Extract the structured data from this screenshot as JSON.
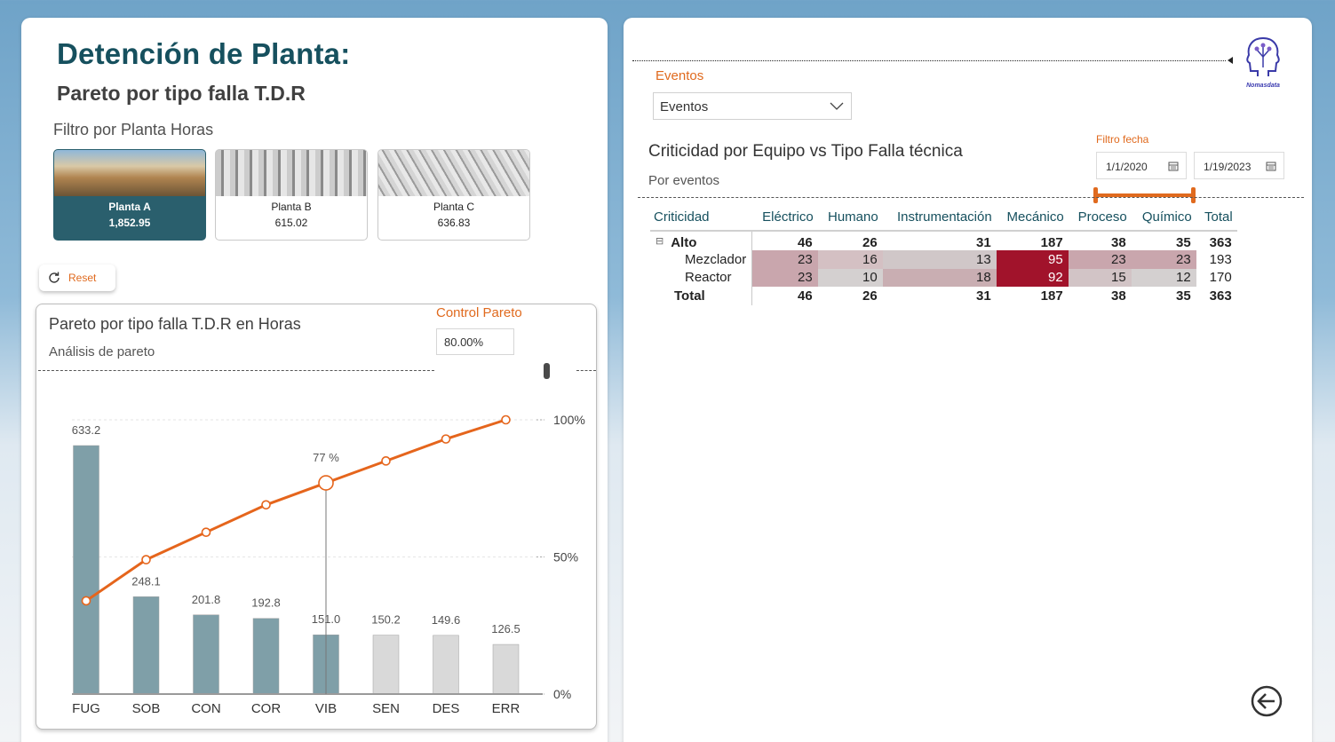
{
  "header": {
    "title": "Detención de Planta:",
    "subtitle": "Pareto por tipo falla T.D.R",
    "filter_label": "Filtro por Planta Horas"
  },
  "plants": [
    {
      "name": "Planta A",
      "value": "1,852.95",
      "active": true
    },
    {
      "name": "Planta B",
      "value": "615.02",
      "active": false
    },
    {
      "name": "Planta C",
      "value": "636.83",
      "active": false
    }
  ],
  "reset": {
    "label": "Reset",
    "icon": "refresh-icon"
  },
  "pareto": {
    "title": "Pareto por tipo falla T.D.R en Horas",
    "subtitle": "Análisis de pareto",
    "control_label": "Control Pareto",
    "control_value": "80.00%",
    "highlight_label": "77 %"
  },
  "chart_data": {
    "type": "bar",
    "title": "Pareto por tipo falla T.D.R en Horas",
    "categories": [
      "FUG",
      "SOB",
      "CON",
      "COR",
      "VIB",
      "SEN",
      "DES",
      "ERR"
    ],
    "series": [
      {
        "values": [
          633.2,
          248.1,
          201.8,
          192.8,
          151.0,
          150.2,
          149.6,
          126.5
        ],
        "labels": [
          "633.2",
          "248.1",
          "201.8",
          "192.8",
          "151.0",
          "150.2",
          "149.6",
          "126.5"
        ]
      },
      {
        "values": [
          34,
          49,
          59,
          69,
          77,
          85,
          93,
          100
        ]
      }
    ],
    "bar_colors": [
      "#7f9fa8",
      "#7f9fa8",
      "#7f9fa8",
      "#7f9fa8",
      "#7f9fa8",
      "#d9d9d9",
      "#d9d9d9",
      "#d9d9d9"
    ],
    "line_color": "#e5651c",
    "y2_ticks": [
      "100%",
      "50%",
      "0%"
    ],
    "y2lim": [
      0,
      100
    ],
    "ylim": [
      0,
      700
    ],
    "highlight_index": 4,
    "threshold_percent": 80
  },
  "right": {
    "eventos_label": "Eventos",
    "eventos_value": "Eventos",
    "matrix_title": "Criticidad por Equipo vs Tipo Falla técnica",
    "matrix_subtitle": "Por eventos",
    "fecha_label": "Filtro fecha",
    "date_start": "1/1/2020",
    "date_end": "1/19/2023",
    "logo_text": "Nomasdata"
  },
  "matrix": {
    "headers": [
      "Criticidad",
      "Eléctrico",
      "Humano",
      "Instrumentación",
      "Mecánico",
      "Proceso",
      "Químico",
      "Total"
    ],
    "rows": [
      {
        "label": "Alto",
        "kind": "alto",
        "values": [
          "46",
          "26",
          "31",
          "187",
          "38",
          "35",
          "363"
        ]
      },
      {
        "label": "Mezclador",
        "kind": "child",
        "values": [
          "23",
          "16",
          "13",
          "95",
          "23",
          "23",
          "193"
        ]
      },
      {
        "label": "Reactor",
        "kind": "child",
        "values": [
          "23",
          "10",
          "18",
          "92",
          "15",
          "12",
          "170"
        ]
      },
      {
        "label": "Total",
        "kind": "total",
        "values": [
          "46",
          "26",
          "31",
          "187",
          "38",
          "35",
          "363"
        ]
      }
    ],
    "cell_colors": [
      [
        "#c9a6ad",
        "#d4c0c3",
        "#d0c7c8",
        "#a1132b",
        "#c9a6ad",
        "#c9a6ad"
      ],
      [
        "#c9a6ad",
        "#d4d0d0",
        "#c9aeb2",
        "#a1132b",
        "#d2c4c6",
        "#d4d0d0"
      ]
    ]
  }
}
